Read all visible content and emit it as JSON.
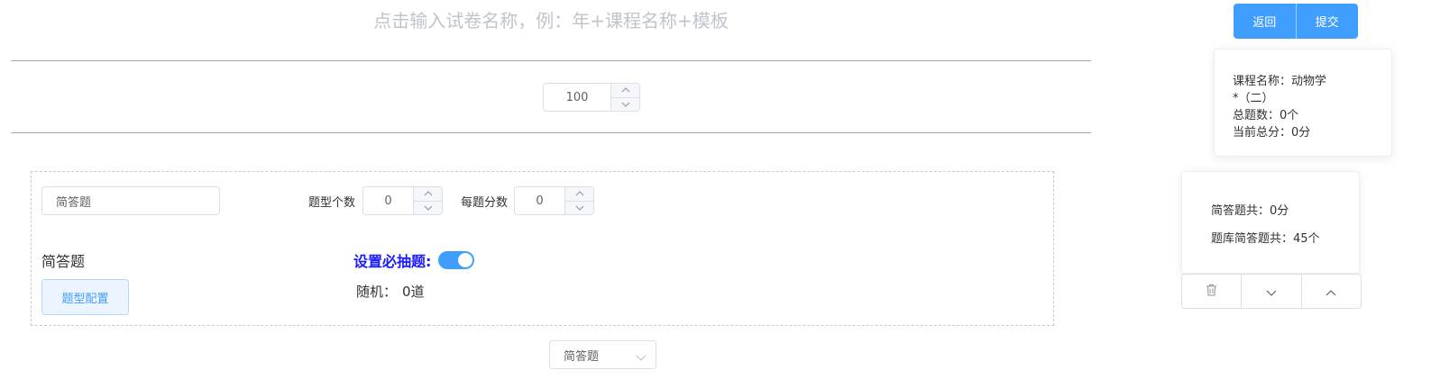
{
  "paper": {
    "title_placeholder": "点击输入试卷名称，例：年+课程名称+模板",
    "total_score": "100"
  },
  "actions": {
    "back_label": "返回",
    "submit_label": "提交"
  },
  "info": {
    "course_line": "课程名称：动物学",
    "course_line2": "*（二）",
    "total_questions": "总题数：0个",
    "current_score": "当前总分：0分"
  },
  "stats": {
    "type_total": "简答题共：0分",
    "bank_total": "题库简答题共：45个"
  },
  "section": {
    "type_name_value": "简答题",
    "count_label": "题型个数",
    "count_value": "0",
    "score_label": "每题分数",
    "score_value": "0",
    "heading": "简答题",
    "config_button": "题型配置",
    "required_label": "设置必抽题:",
    "required_on": true,
    "random_label": "随机：",
    "random_value": "0道"
  },
  "add_type": {
    "selected": "简答题"
  },
  "icons": {
    "delete": "trash-icon",
    "move_down": "chevron-down-icon",
    "move_up": "chevron-up-icon"
  },
  "colors": {
    "primary": "#409eff",
    "required_label": "#1a1aff"
  }
}
